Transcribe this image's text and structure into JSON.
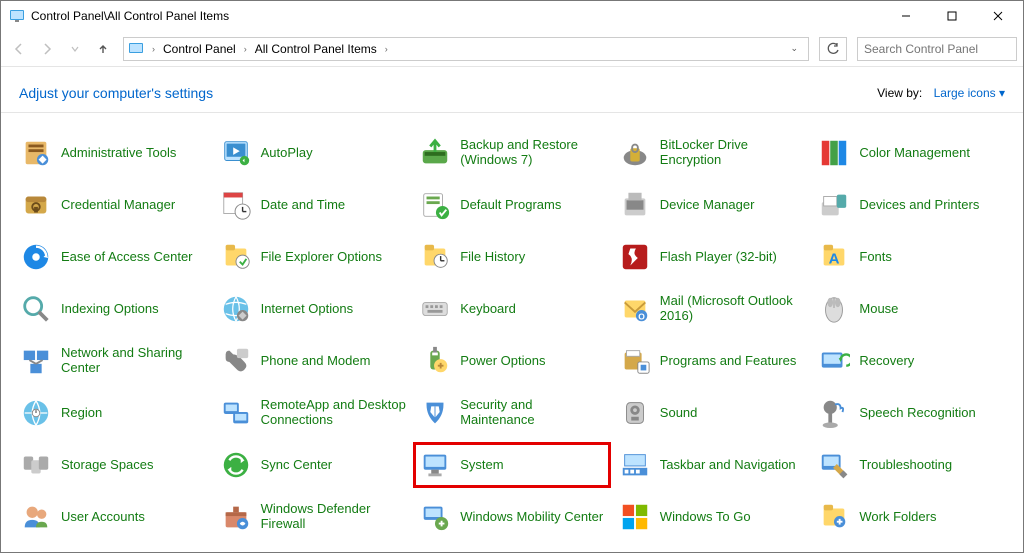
{
  "window": {
    "title": "Control Panel\\All Control Panel Items"
  },
  "breadcrumb": {
    "root": "Control Panel",
    "leaf": "All Control Panel Items"
  },
  "search": {
    "placeholder": "Search Control Panel"
  },
  "header": {
    "heading": "Adjust your computer's settings",
    "viewby_label": "View by:",
    "viewby_value": "Large icons "
  },
  "items": {
    "i0": {
      "label": "Administrative Tools"
    },
    "i1": {
      "label": "AutoPlay"
    },
    "i2": {
      "label": "Backup and Restore (Windows 7)"
    },
    "i3": {
      "label": "BitLocker Drive Encryption"
    },
    "i4": {
      "label": "Color Management"
    },
    "i5": {
      "label": "Credential Manager"
    },
    "i6": {
      "label": "Date and Time"
    },
    "i7": {
      "label": "Default Programs"
    },
    "i8": {
      "label": "Device Manager"
    },
    "i9": {
      "label": "Devices and Printers"
    },
    "i10": {
      "label": "Ease of Access Center"
    },
    "i11": {
      "label": "File Explorer Options"
    },
    "i12": {
      "label": "File History"
    },
    "i13": {
      "label": "Flash Player (32-bit)"
    },
    "i14": {
      "label": "Fonts"
    },
    "i15": {
      "label": "Indexing Options"
    },
    "i16": {
      "label": "Internet Options"
    },
    "i17": {
      "label": "Keyboard"
    },
    "i18": {
      "label": "Mail (Microsoft Outlook 2016)"
    },
    "i19": {
      "label": "Mouse"
    },
    "i20": {
      "label": "Network and Sharing Center"
    },
    "i21": {
      "label": "Phone and Modem"
    },
    "i22": {
      "label": "Power Options"
    },
    "i23": {
      "label": "Programs and Features"
    },
    "i24": {
      "label": "Recovery"
    },
    "i25": {
      "label": "Region"
    },
    "i26": {
      "label": "RemoteApp and Desktop Connections"
    },
    "i27": {
      "label": "Security and Maintenance"
    },
    "i28": {
      "label": "Sound"
    },
    "i29": {
      "label": "Speech Recognition"
    },
    "i30": {
      "label": "Storage Spaces"
    },
    "i31": {
      "label": "Sync Center"
    },
    "i32": {
      "label": "System"
    },
    "i33": {
      "label": "Taskbar and Navigation"
    },
    "i34": {
      "label": "Troubleshooting"
    },
    "i35": {
      "label": "User Accounts"
    },
    "i36": {
      "label": "Windows Defender Firewall"
    },
    "i37": {
      "label": "Windows Mobility Center"
    },
    "i38": {
      "label": "Windows To Go"
    },
    "i39": {
      "label": "Work Folders"
    }
  },
  "highlight_key": "i32",
  "colors": {
    "link": "#137c13",
    "accent": "#0066cc",
    "highlight": "#e30000"
  }
}
